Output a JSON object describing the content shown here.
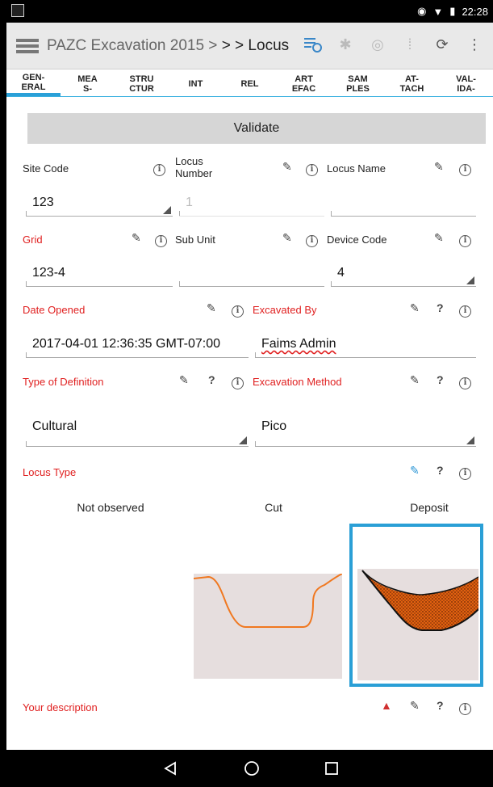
{
  "status_bar": {
    "time": "22:28"
  },
  "app_bar": {
    "title": "PAZC Excavation 2015 >",
    "title_suffix": "> > Locus"
  },
  "tabs": [
    {
      "label_1": "GEN-",
      "label_2": "ERAL",
      "active": true
    },
    {
      "label_1": "MEA",
      "label_2": "S-",
      "active": false
    },
    {
      "label_1": "STRU",
      "label_2": "CTUR",
      "active": false
    },
    {
      "label_1": "INT",
      "label_2": "",
      "active": false
    },
    {
      "label_1": "REL",
      "label_2": "",
      "active": false
    },
    {
      "label_1": "ART",
      "label_2": "EFAC",
      "active": false
    },
    {
      "label_1": "SAM",
      "label_2": "PLES",
      "active": false
    },
    {
      "label_1": "AT-",
      "label_2": "TACH",
      "active": false
    },
    {
      "label_1": "VAL-",
      "label_2": "IDA-",
      "active": false
    }
  ],
  "validate_label": "Validate",
  "fields": {
    "site_code": {
      "label": "Site Code",
      "value": "123"
    },
    "locus_number": {
      "label_1": "Locus",
      "label_2": "Number",
      "value": "1"
    },
    "locus_name": {
      "label": "Locus Name",
      "value": ""
    },
    "grid": {
      "label": "Grid",
      "value": "123-4"
    },
    "sub_unit": {
      "label": "Sub Unit",
      "value": ""
    },
    "device_code": {
      "label": "Device Code",
      "value": "4"
    },
    "date_opened": {
      "label": "Date Opened",
      "value": "2017-04-01 12:36:35 GMT-07:00"
    },
    "excavated_by": {
      "label": "Excavated By",
      "value": "Faims Admin"
    },
    "type_of_definition": {
      "label": "Type of Definition",
      "value": "Cultural"
    },
    "excavation_method": {
      "label": "Excavation Method",
      "value": "Pico"
    },
    "locus_type": {
      "label": "Locus Type",
      "options": [
        "Not observed",
        "Cut",
        "Deposit"
      ],
      "selected": "Deposit"
    },
    "your_description": {
      "label": "Your description"
    }
  },
  "colors": {
    "required_label": "#e02020",
    "accent": "#2aa0d8",
    "cut_line": "#f07820",
    "deposit_fill": "#e06010"
  }
}
